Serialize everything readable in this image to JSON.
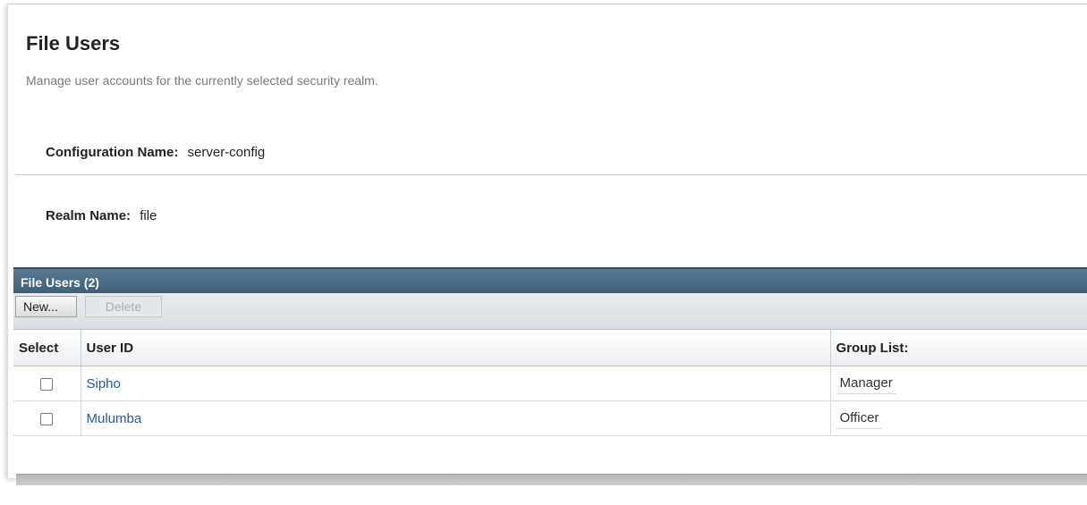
{
  "page": {
    "title": "File Users",
    "description": "Manage user accounts for the currently selected security realm."
  },
  "properties": {
    "configuration_label": "Configuration Name:",
    "configuration_value": "server-config",
    "realm_label": "Realm Name:",
    "realm_value": "file"
  },
  "table": {
    "title": "File Users (2)",
    "new_label": "New...",
    "delete_label": "Delete",
    "columns": [
      "Select",
      "User ID",
      "Group List:"
    ],
    "rows": [
      {
        "user_id": "Sipho",
        "group_list": "Manager"
      },
      {
        "user_id": "Mulumba",
        "group_list": "Officer"
      }
    ]
  }
}
